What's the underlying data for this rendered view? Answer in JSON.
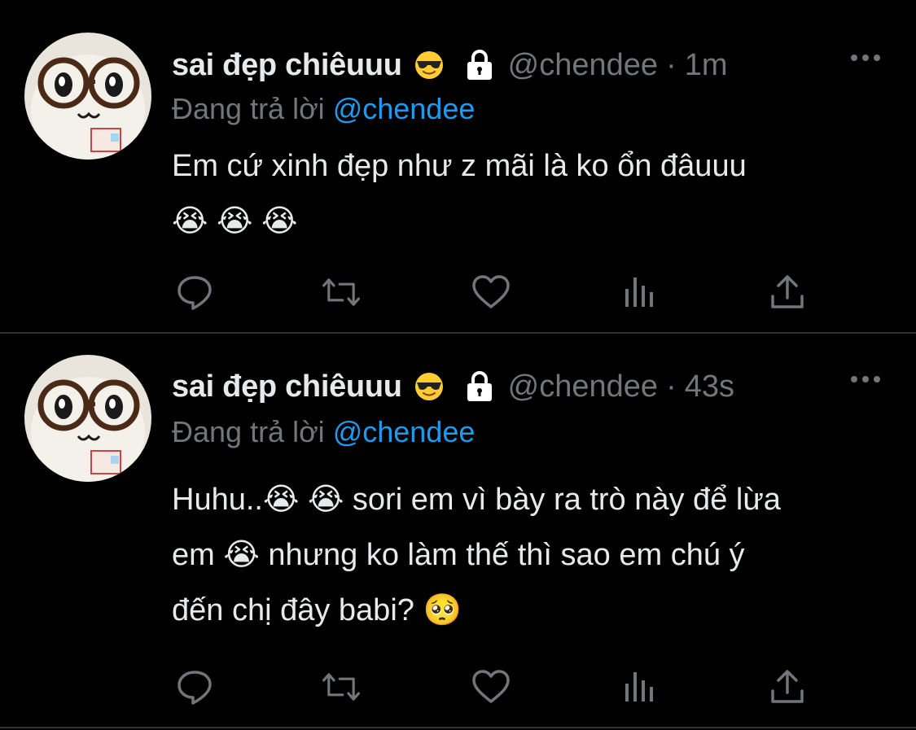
{
  "colors": {
    "background": "#000000",
    "text_primary": "#e7e9ea",
    "text_secondary": "#71767b",
    "mention": "#1d9bf0",
    "divider": "#2f3336"
  },
  "tweets": [
    {
      "display_name": "sai đẹp chiêuuu",
      "name_emoji": "smiling-face-with-sunglasses",
      "protected_icon": "lock-icon",
      "handle": "@chendee",
      "separator": "·",
      "time": "1m",
      "replying_prefix": "Đang trả lời",
      "replying_to": "@chendee",
      "lines": [
        [
          "Em cứ xinh đẹp như z mãi là ko ổn đâuuu"
        ],
        [
          "😭",
          "😭",
          "😭"
        ]
      ],
      "actions": [
        "reply-icon",
        "retweet-icon",
        "like-icon",
        "views-icon",
        "share-icon"
      ]
    },
    {
      "display_name": "sai đẹp chiêuuu",
      "name_emoji": "smiling-face-with-sunglasses",
      "protected_icon": "lock-icon",
      "handle": "@chendee",
      "separator": "·",
      "time": "43s",
      "replying_prefix": "Đang trả lời",
      "replying_to": "@chendee",
      "lines": [
        [
          "Huhu..",
          "😭",
          "😭",
          "sori em vì bày ra trò này để lừa"
        ],
        [
          "em",
          "😭",
          "nhưng ko làm thế thì sao em chú ý"
        ],
        [
          "đến chị đây babi?",
          "🥺"
        ]
      ],
      "actions": [
        "reply-icon",
        "retweet-icon",
        "like-icon",
        "views-icon",
        "share-icon"
      ]
    }
  ]
}
